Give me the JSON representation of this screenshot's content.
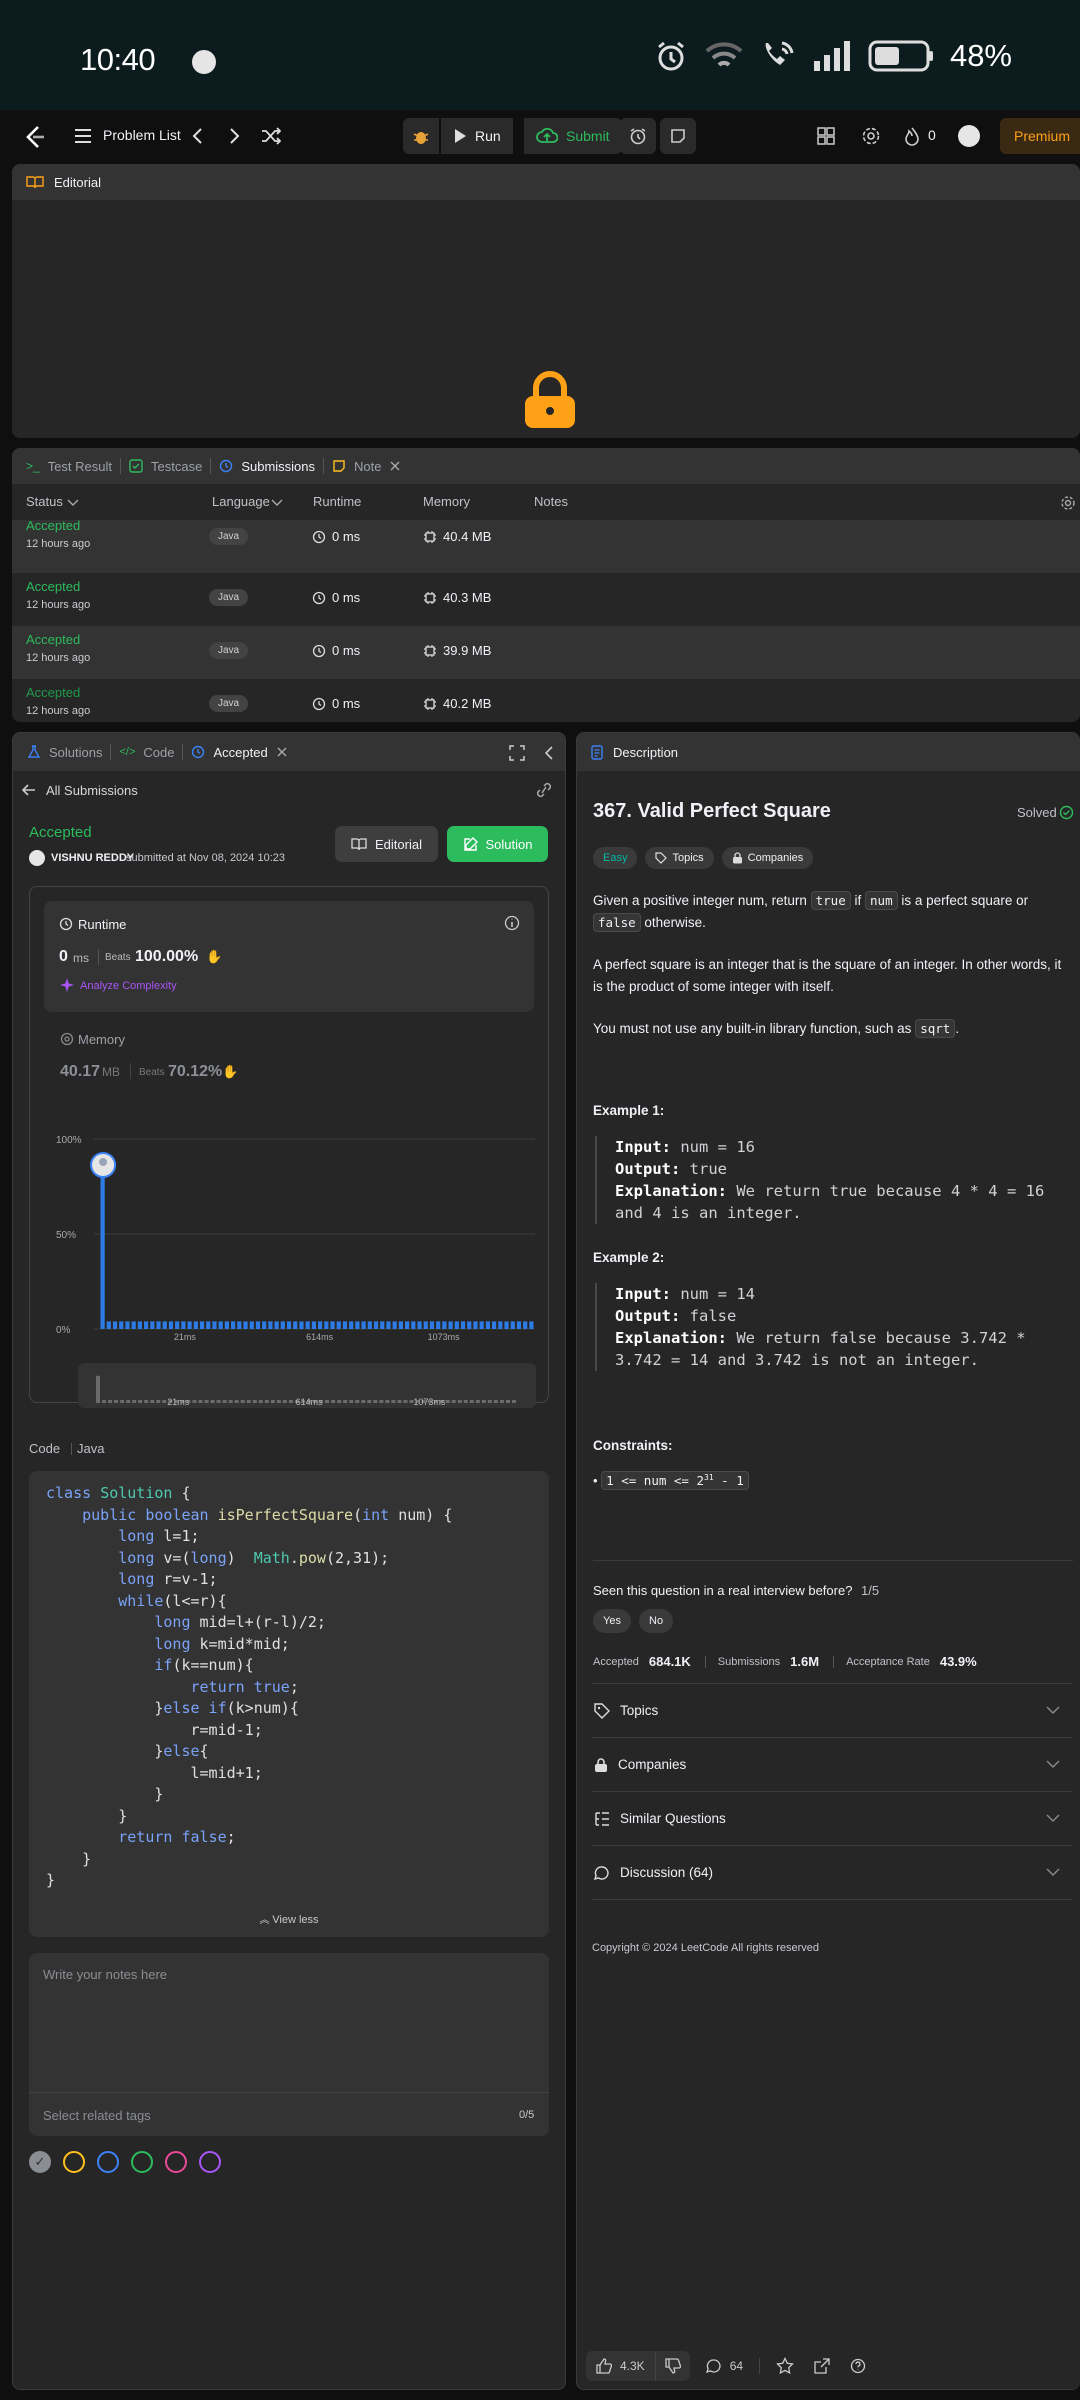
{
  "status_bar": {
    "time": "10:40",
    "battery": "48%"
  },
  "toolbar": {
    "problem_list": "Problem List",
    "run": "Run",
    "submit": "Submit",
    "streak": "0",
    "premium": "Premium"
  },
  "editorial_panel": {
    "title": "Editorial"
  },
  "results_panel": {
    "tabs": [
      "Test Result",
      "Testcase",
      "Submissions",
      "Note"
    ],
    "columns": [
      "Status",
      "Language",
      "Runtime",
      "Memory",
      "Notes"
    ],
    "rows": [
      {
        "status": "Accepted",
        "ago": "12 hours ago",
        "lang": "Java",
        "runtime": "0 ms",
        "memory": "40.4 MB"
      },
      {
        "status": "Accepted",
        "ago": "12 hours ago",
        "lang": "Java",
        "runtime": "0 ms",
        "memory": "40.3 MB"
      },
      {
        "status": "Accepted",
        "ago": "12 hours ago",
        "lang": "Java",
        "runtime": "0 ms",
        "memory": "39.9 MB"
      },
      {
        "status": "Accepted",
        "ago": "12 hours ago",
        "lang": "Java",
        "runtime": "0 ms",
        "memory": "40.2 MB"
      }
    ]
  },
  "submission_panel": {
    "tabs": [
      "Solutions",
      "Code",
      "Accepted"
    ],
    "back": "All Submissions",
    "status": "Accepted",
    "user": "VISHNU REDDY",
    "submitted_at": "submitted at Nov 08, 2024 10:23",
    "editorial_btn": "Editorial",
    "solution_btn": "Solution",
    "runtime_label": "Runtime",
    "runtime_value": "0",
    "runtime_unit": "ms",
    "beats_label": "Beats",
    "runtime_beats": "100.00%",
    "analyze": "Analyze Complexity",
    "memory_label": "Memory",
    "memory_value": "40.17",
    "memory_unit": "MB",
    "memory_beats": "70.12%",
    "code_label": "Code",
    "code_lang": "Java",
    "view_less": "View less",
    "notes_placeholder": "Write your notes here",
    "tags_placeholder": "Select related tags",
    "tags_count": "0/5"
  },
  "chart_data": {
    "type": "bar",
    "y_ticks": [
      "100%",
      "50%",
      "0%"
    ],
    "x_ticks": [
      "21ms",
      "614ms",
      "1073ms"
    ],
    "values": [
      80,
      4,
      4,
      4,
      4,
      4,
      4,
      4,
      4,
      4,
      4,
      4,
      4,
      4,
      4,
      4,
      4,
      4,
      4,
      4,
      4,
      4,
      4,
      4,
      4,
      4,
      4,
      4,
      4,
      4,
      4,
      4,
      4,
      4,
      4,
      4,
      4,
      4,
      4,
      4,
      4,
      4,
      4,
      4,
      4,
      4,
      4,
      4,
      4,
      4,
      4,
      4,
      4,
      4,
      4,
      4,
      4,
      4,
      4,
      4,
      4,
      4,
      4,
      4,
      4,
      4,
      4,
      4,
      4,
      4
    ],
    "ylim": [
      0,
      100
    ],
    "colors": {
      "bar": "#2d7be5",
      "grid": "#3c3c3c"
    }
  },
  "code_lines": [
    [
      [
        "kw",
        "class "
      ],
      [
        "ty",
        "Solution"
      ],
      [
        "plain",
        " {"
      ]
    ],
    [
      [
        "plain",
        "    "
      ],
      [
        "kw",
        "public boolean "
      ],
      [
        "fn",
        "isPerfectSquare"
      ],
      [
        "plain",
        "("
      ],
      [
        "kw",
        "int"
      ],
      [
        "plain",
        " num) {"
      ]
    ],
    [
      [
        "plain",
        "        "
      ],
      [
        "kw",
        "long"
      ],
      [
        "plain",
        " l=1;"
      ]
    ],
    [
      [
        "plain",
        "        "
      ],
      [
        "kw",
        "long"
      ],
      [
        "plain",
        " v=("
      ],
      [
        "kw",
        "long"
      ],
      [
        "plain",
        ")  "
      ],
      [
        "ty",
        "Math"
      ],
      [
        "plain",
        "."
      ],
      [
        "fn",
        "pow"
      ],
      [
        "plain",
        "(2,31);"
      ]
    ],
    [
      [
        "plain",
        "        "
      ],
      [
        "kw",
        "long"
      ],
      [
        "plain",
        " r=v-1;"
      ]
    ],
    [
      [
        "plain",
        "        "
      ],
      [
        "kw",
        "while"
      ],
      [
        "plain",
        "(l<=r){"
      ]
    ],
    [
      [
        "plain",
        "            "
      ],
      [
        "kw",
        "long"
      ],
      [
        "plain",
        " mid=l+(r-l)/2;"
      ]
    ],
    [
      [
        "plain",
        "            "
      ],
      [
        "kw",
        "long"
      ],
      [
        "plain",
        " k=mid*mid;"
      ]
    ],
    [
      [
        "plain",
        "            "
      ],
      [
        "kw",
        "if"
      ],
      [
        "plain",
        "(k==num){"
      ]
    ],
    [
      [
        "plain",
        "                "
      ],
      [
        "kw",
        "return true"
      ],
      [
        "plain",
        ";"
      ]
    ],
    [
      [
        "plain",
        "            }"
      ],
      [
        "kw",
        "else if"
      ],
      [
        "plain",
        "(k>num){"
      ]
    ],
    [
      [
        "plain",
        "                r=mid-1;"
      ]
    ],
    [
      [
        "plain",
        "            }"
      ],
      [
        "kw",
        "else"
      ],
      [
        "plain",
        "{"
      ]
    ],
    [
      [
        "plain",
        "                l=mid+1;"
      ]
    ],
    [
      [
        "plain",
        "            }"
      ]
    ],
    [
      [
        "plain",
        "        }"
      ]
    ],
    [
      [
        "plain",
        "        "
      ],
      [
        "kw",
        "return false"
      ],
      [
        "plain",
        ";"
      ]
    ],
    [
      [
        "plain",
        "    }"
      ]
    ],
    [
      [
        "plain",
        "}"
      ]
    ]
  ],
  "description_panel": {
    "tab": "Description",
    "title": "367. Valid Perfect Square",
    "solved": "Solved",
    "difficulty": "Easy",
    "topics_chip": "Topics",
    "companies_chip": "Companies",
    "p1_a": "Given a positive integer num, return",
    "p1_true": "true",
    "p1_b": "if",
    "p1_num": "num",
    "p1_c": "is a perfect square or",
    "p1_false": "false",
    "p1_d": "otherwise.",
    "p2": "A perfect square is an integer that is the square of an integer. In other words, it is the product of some integer with itself.",
    "p3_a": "You must not use any built-in library function, such as",
    "p3_code": "sqrt",
    "ex1_title": "Example 1:",
    "ex1_input": "num = 16",
    "ex1_output": "true",
    "ex1_expl_1": "We return true because 4 * 4 = 16",
    "ex1_expl_2": "and 4 is an integer.",
    "ex2_title": "Example 2:",
    "ex2_input": "num = 14",
    "ex2_output": "false",
    "ex2_expl_1": "We return false because 3.742 *",
    "ex2_expl_2": "3.742 = 14 and 3.742 is not an integer.",
    "input_label": "Input:",
    "output_label": "Output:",
    "expl_label": "Explanation:",
    "constraints_title": "Constraints:",
    "constraint_a": "1 <= num <= 2",
    "constraint_sup": "31",
    "constraint_b": " - 1",
    "interview_q": "Seen this question in a real interview before?",
    "interview_count": "1/5",
    "yes": "Yes",
    "no": "No",
    "accepted_label": "Accepted",
    "accepted_value": "684.1K",
    "submissions_label": "Submissions",
    "submissions_value": "1.6M",
    "rate_label": "Acceptance Rate",
    "rate_value": "43.9%",
    "acc_topics": "Topics",
    "acc_companies": "Companies",
    "acc_similar": "Similar Questions",
    "acc_discussion": "Discussion (64)",
    "copyright": "Copyright © 2024 LeetCode All rights reserved",
    "likes": "4.3K",
    "comments": "64"
  }
}
